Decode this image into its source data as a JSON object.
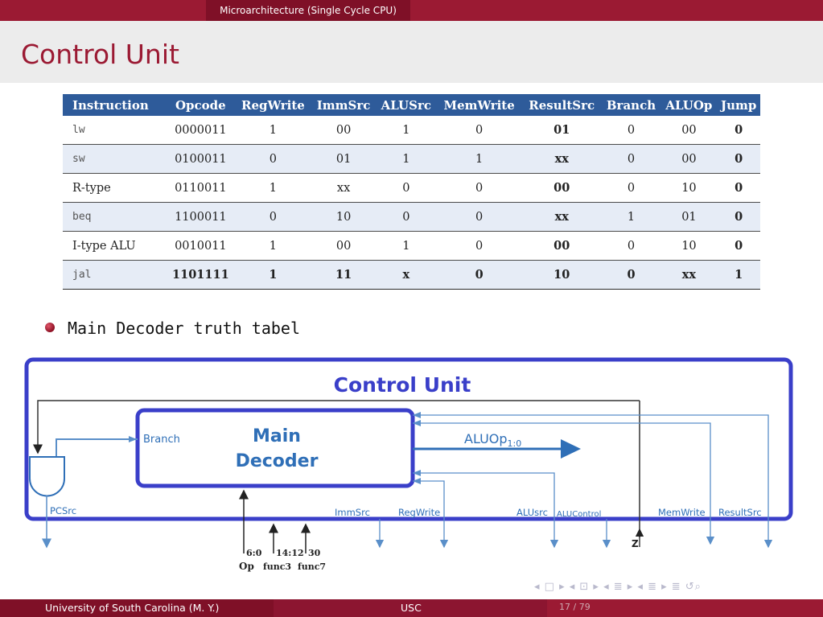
{
  "header": {
    "section": "Microarchitecture (Single Cycle CPU)"
  },
  "slide": {
    "title": "Control Unit"
  },
  "table": {
    "columns": [
      "Instruction",
      "Opcode",
      "RegWrite",
      "ImmSrc",
      "ALUSrc",
      "MemWrite",
      "ResultSrc",
      "Branch",
      "ALUOp",
      "Jump"
    ],
    "rows": [
      [
        "lw",
        "0000011",
        "1",
        "00",
        "1",
        "0",
        "01",
        "0",
        "00",
        "0"
      ],
      [
        "sw",
        "0100011",
        "0",
        "01",
        "1",
        "1",
        "xx",
        "0",
        "00",
        "0"
      ],
      [
        "R-type",
        "0110011",
        "1",
        "xx",
        "0",
        "0",
        "00",
        "0",
        "10",
        "0"
      ],
      [
        "beq",
        "1100011",
        "0",
        "10",
        "0",
        "0",
        "xx",
        "1",
        "01",
        "0"
      ],
      [
        "I-type ALU",
        "0010011",
        "1",
        "00",
        "1",
        "0",
        "00",
        "0",
        "10",
        "0"
      ],
      [
        "jal",
        "1101111",
        "1",
        "11",
        "x",
        "0",
        "10",
        "0",
        "xx",
        "1"
      ]
    ]
  },
  "bullet": {
    "text": "Main Decoder truth tabel"
  },
  "diagram": {
    "title": "Control Unit",
    "main_decoder_line1": "Main",
    "main_decoder_line2": "Decoder",
    "branch": "Branch",
    "aluop": "ALUOp",
    "aluop_sub": "1:0",
    "pcsrc": "PCSrc",
    "immsrc": "ImmSrc",
    "regwrite": "RegWrite",
    "alusrc": "ALUsrc",
    "alucontrol": "ALUControl",
    "memwrite": "MemWrite",
    "resultsrc": "ResultSrc",
    "z": "Z",
    "op_bits": "6:0",
    "func3_bits": "14:12",
    "func7_bits": "30",
    "op": "Op",
    "func3": "func3",
    "func7": "func7",
    "accent_color": "#3a3fc9"
  },
  "footer": {
    "left": "University of South Carolina  (M. Y.)",
    "center": "USC",
    "page": "17 / 79"
  },
  "nav": {
    "symbols": "◂ □ ▸ ◂ ⊡ ▸ ◂ ≣ ▸ ◂ ≣ ▸   ≣   ↺⌕"
  }
}
